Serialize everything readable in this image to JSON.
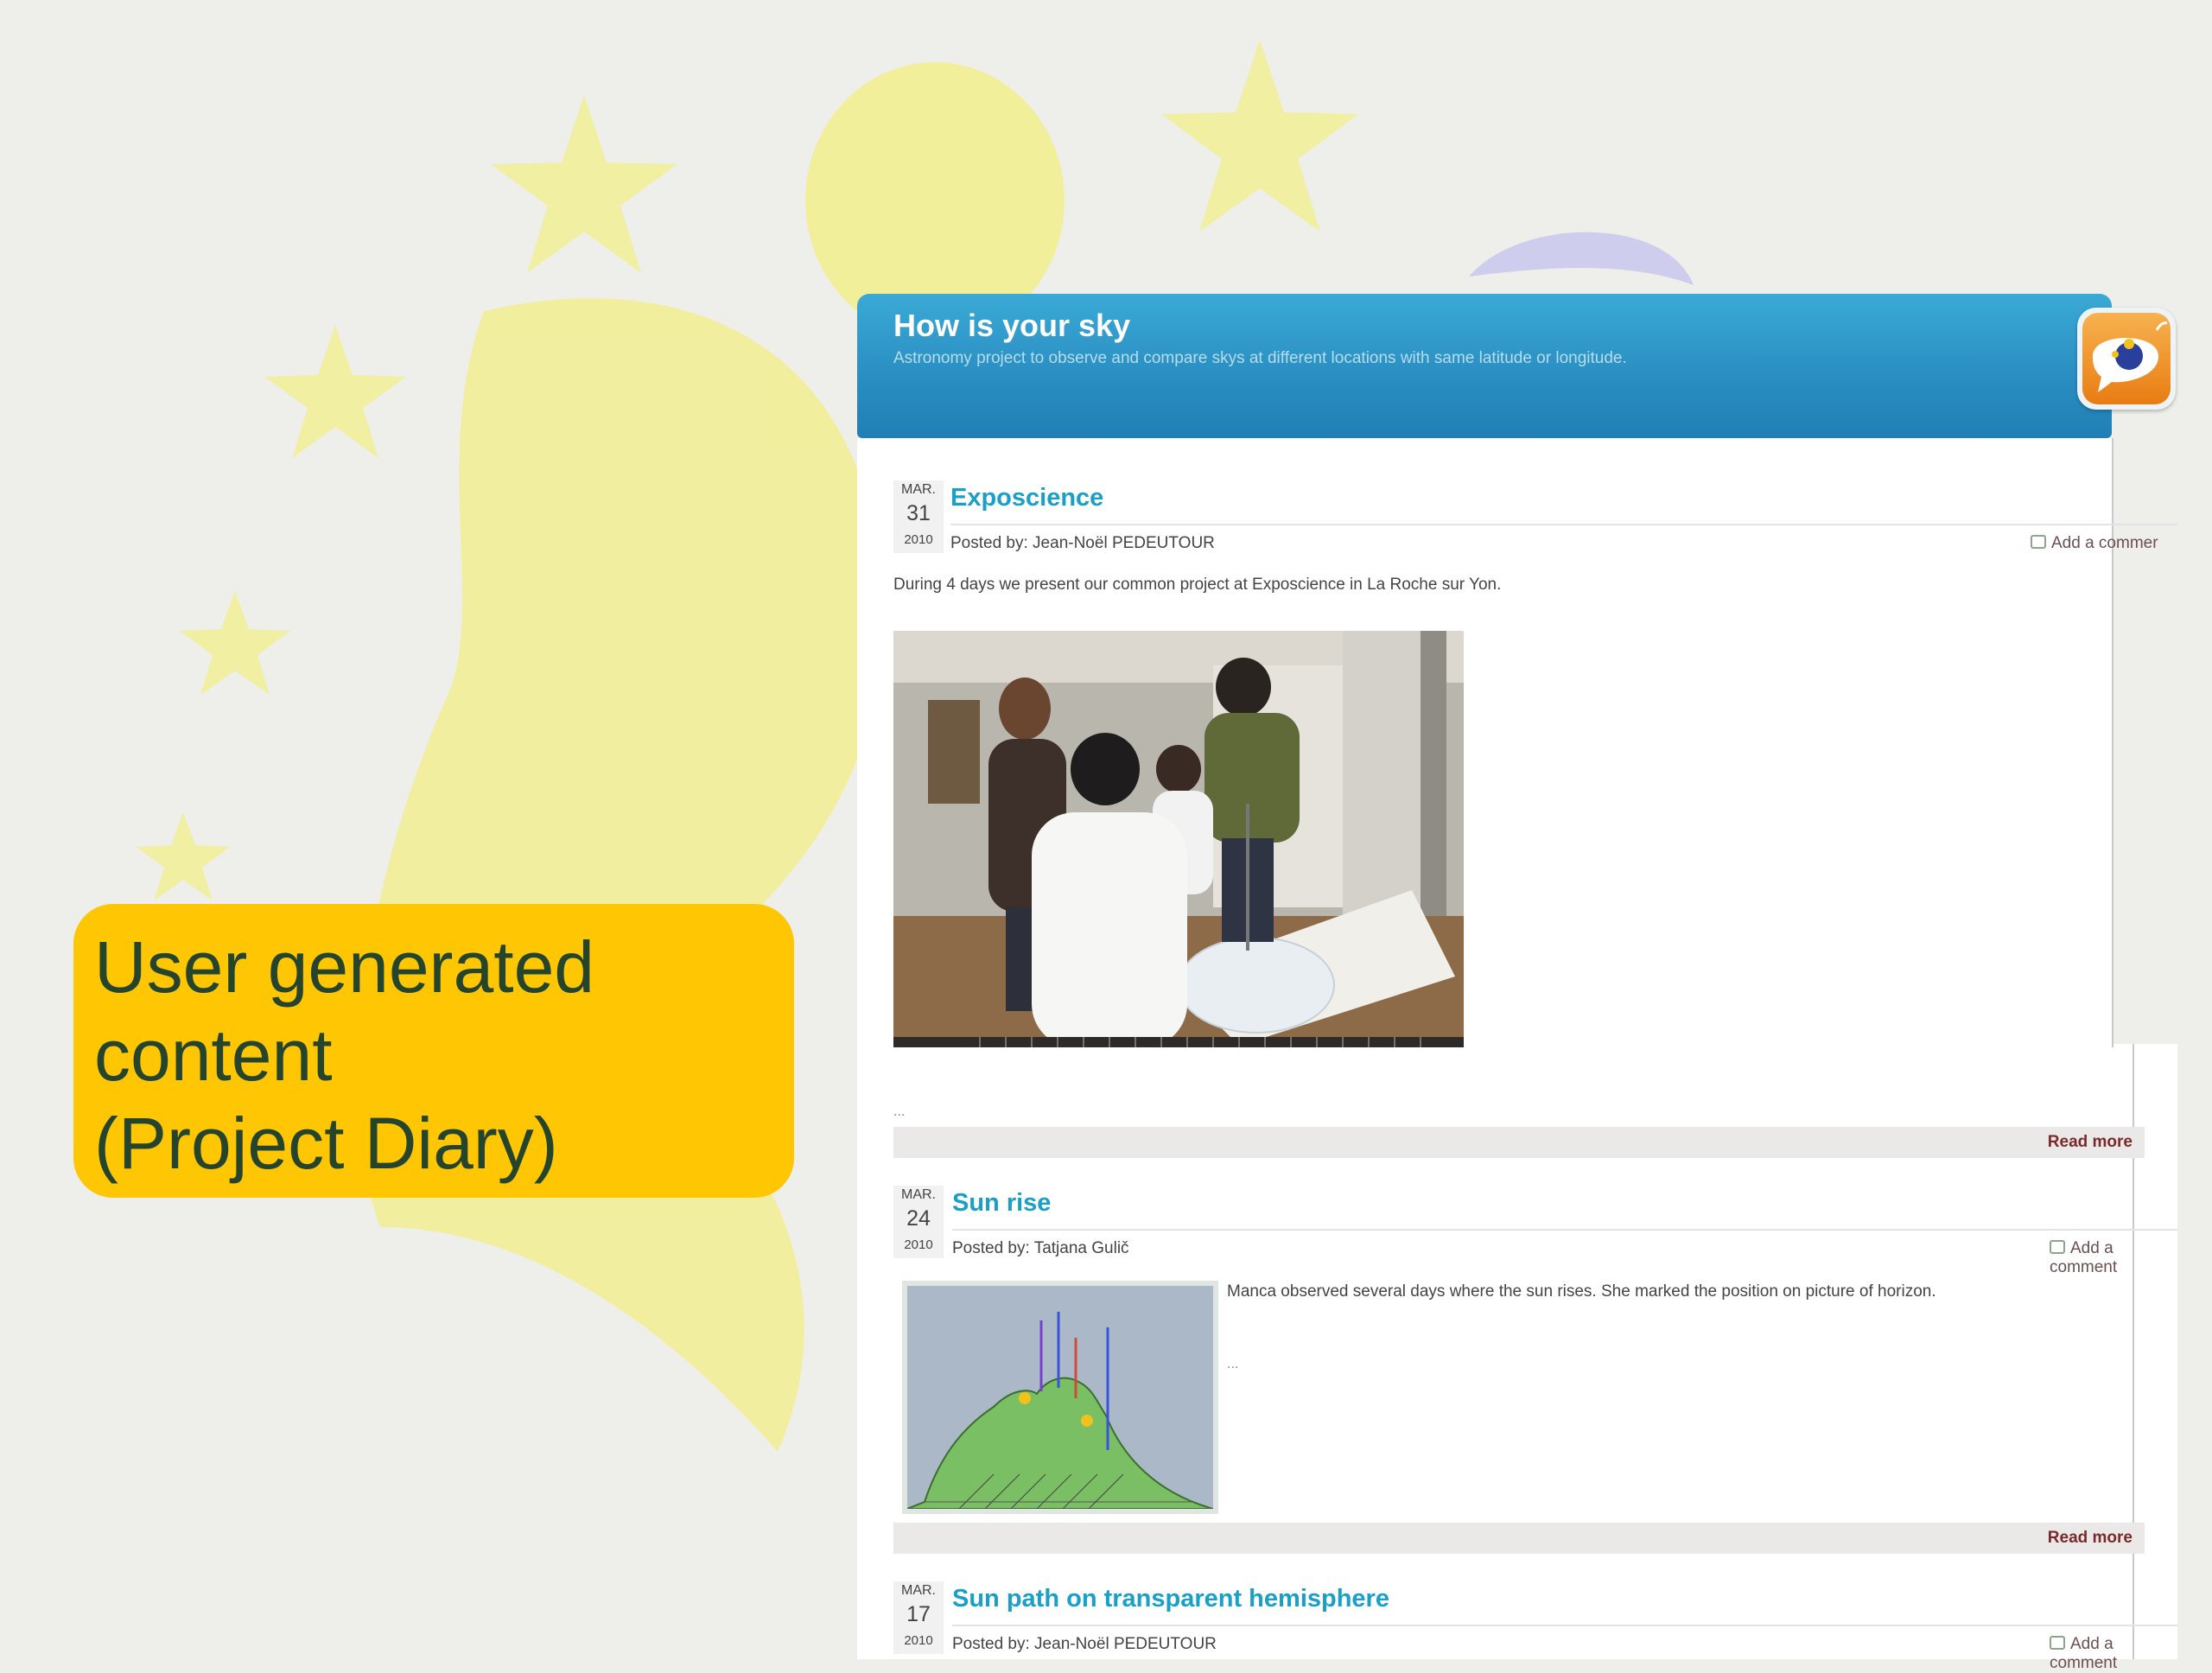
{
  "slide": {
    "callout": {
      "lines": [
        "User generated",
        "content",
        "(Project Diary)"
      ]
    }
  },
  "site": {
    "title": "How is your sky",
    "subtitle": "Astronomy project to observe and compare skys at different locations with same latitude or longitude."
  },
  "posts": [
    {
      "month": "MAR.",
      "day": "31",
      "year": "2010",
      "title": "Exposcience",
      "byline": "Posted by: Jean-Noël PEDEUTOUR",
      "add_comment": "Add a commer",
      "excerpt": "During 4 days we present our common project at Exposcience in La Roche sur Yon.",
      "ellipsis": "...",
      "read_more": "Read more"
    },
    {
      "month": "MAR.",
      "day": "24",
      "year": "2010",
      "title": "Sun rise",
      "byline": "Posted by: Tatjana Gulič",
      "add_comment": "Add a comment",
      "excerpt": "Manca observed several days where the sun rises. She marked the position on picture of horizon.",
      "ellipsis": "...",
      "read_more": "Read more"
    },
    {
      "month": "MAR.",
      "day": "17",
      "year": "2010",
      "title": "Sun path on transparent hemisphere",
      "byline": "Posted by: Jean-Noël PEDEUTOUR",
      "add_comment": "Add a comment"
    }
  ],
  "colors": {
    "header_blue": "#2b8fc3",
    "post_title": "#1aa0c6",
    "callout_yellow": "#fec603",
    "callout_text": "#25442c",
    "read_more": "#7a2a2a"
  },
  "icons": [
    "comment-icon",
    "project-logo-icon"
  ]
}
